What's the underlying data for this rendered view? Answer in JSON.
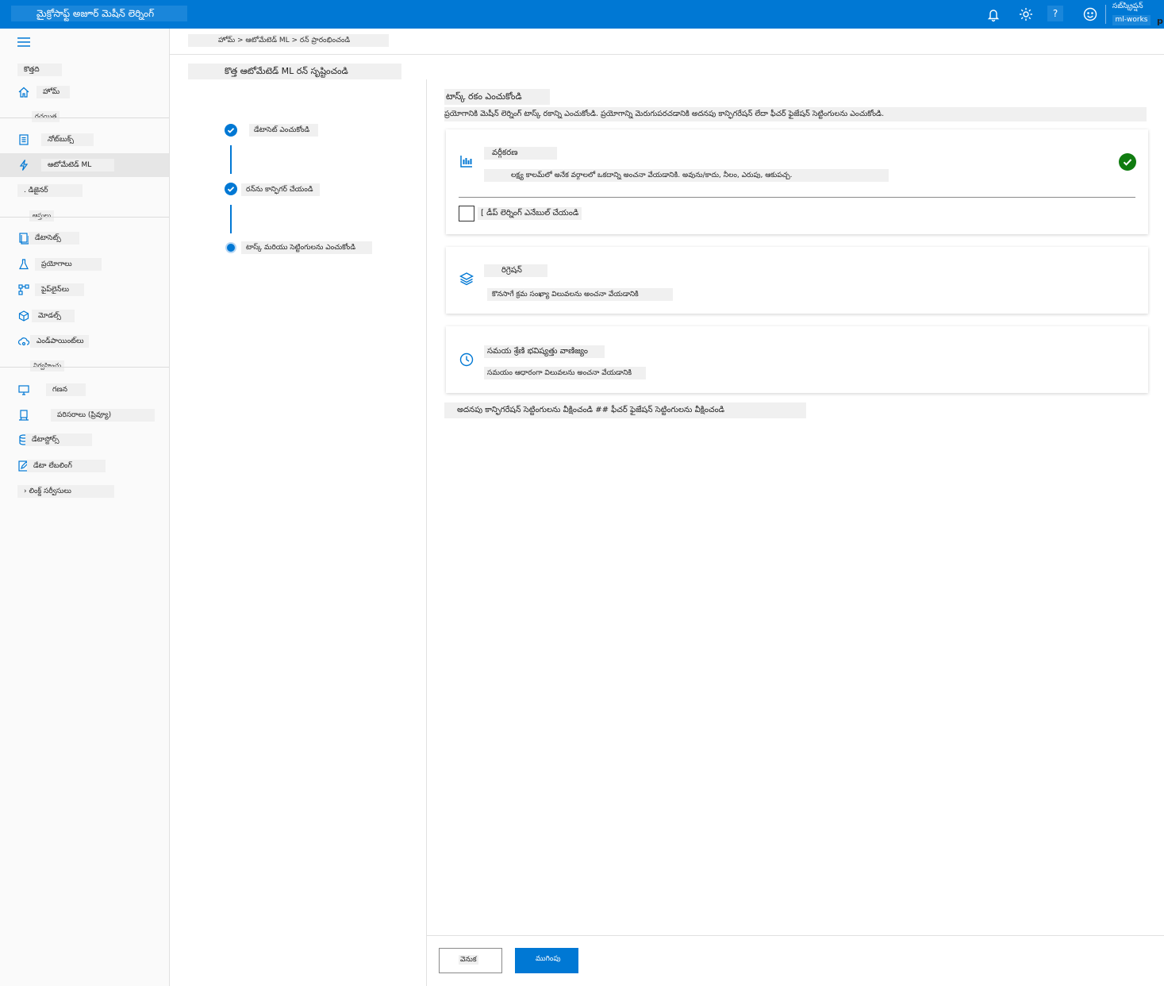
{
  "topbar": {
    "app_title": "మైక్రోసాఫ్ట్ అజూర్ మెషీన్ లెర్నింగ్",
    "help": "?",
    "subscription": "సబ్‌స్క్రిప్షన్",
    "workspace": "ml-works",
    "avatar": "p",
    "icons": [
      "bell-icon",
      "gear-icon",
      "help-icon",
      "smiley-icon"
    ]
  },
  "sidebar": {
    "new_label": "కొత్తది",
    "home": "హోమ్",
    "section_author": "రచయిత",
    "notebooks": "నోట్‌బుక్స్",
    "automated_ml": "ఆటోమేటెడ్ ML",
    "designer": ". డిజైనర్",
    "section_assets": "ఆస్తులు",
    "datasets": "డేటాసెట్స్",
    "experiments": "ప్రయోగాలు",
    "pipelines": "పైప్‌లైన్‌లు",
    "models": "మోడల్స్",
    "endpoints": "ఎండ్‌పాయింట్‌లు",
    "section_manage": "నిర్వహించు",
    "compute": "గణన",
    "environments": "పరిసరాలు (ప్రివ్యూ)",
    "datastores": "డేటాస్టోర్స్",
    "data_labeling": "డేటా లేబలింగ్",
    "linked_services": "› లింక్డ్ సర్వీసులు"
  },
  "breadcrumb": "హోమ్ > ఆటోమేటెడ్ ML > రన్ ప్రారంభించండి",
  "page_title": "కొత్త ఆటోమేటెడ్ ML రన్ సృష్టించండి",
  "steps": [
    {
      "label": "డేటాసెట్ ఎంచుకోండి",
      "state": "done"
    },
    {
      "label": "రన్‌ను కాన్ఫిగర్ చేయండి",
      "state": "done"
    },
    {
      "label": "టాస్క్ మరియు సెట్టింగులను ఎంచుకోండి",
      "state": "current"
    }
  ],
  "content": {
    "title": "టాస్క్ రకం ఎంచుకోండి",
    "description": "ప్రయోగానికి మెషీన్ లెర్నింగ్ టాస్క్ రకాన్ని ఎంచుకోండి. ప్రయోగాన్ని మెరుగుపరచడానికి అదనపు కాన్ఫిగరేషన్ లేదా ఫీచర్ ఫైజేషన్ సెట్టింగులను ఎంచుకోండి.",
    "cards": [
      {
        "title": "వర్గీకరణ",
        "description": "లక్ష్య కాలమ్‌లో అనేక వర్గాలలో ఒకదాన్ని అంచనా వేయడానికి. అవును/కాదు, నీలం, ఎరుపు, ఆకుపచ్చ.",
        "icon": "bar-chart-icon",
        "selected": true,
        "checkbox_label": "[ డీప్ లెర్నింగ్ ఎనేబుల్ చేయండి"
      },
      {
        "title": "రిగ్రెషన్",
        "description": "కొనసాగే క్రమ సంఖ్యా విలువలను అంచనా వేయడానికి",
        "icon": "layers-icon",
        "selected": false
      },
      {
        "title": "సమయ శ్రేణి భవిష్యత్తు వాణిజ్యం",
        "description": "సమయం ఆధారంగా విలువలను అంచనా వేయడానికి",
        "icon": "clock-icon",
        "selected": false
      }
    ],
    "advanced_link": "అదనపు కాన్ఫిగరేషన్ సెట్టింగులను వీక్షించండి ## ఫీచర్ ఫైజేషన్ సెట్టింగులను వీక్షించండి"
  },
  "footer": {
    "back": "వెనుక",
    "finish": "ముగింపు"
  },
  "colors": {
    "accent": "#0078d4",
    "success": "#107c10"
  }
}
